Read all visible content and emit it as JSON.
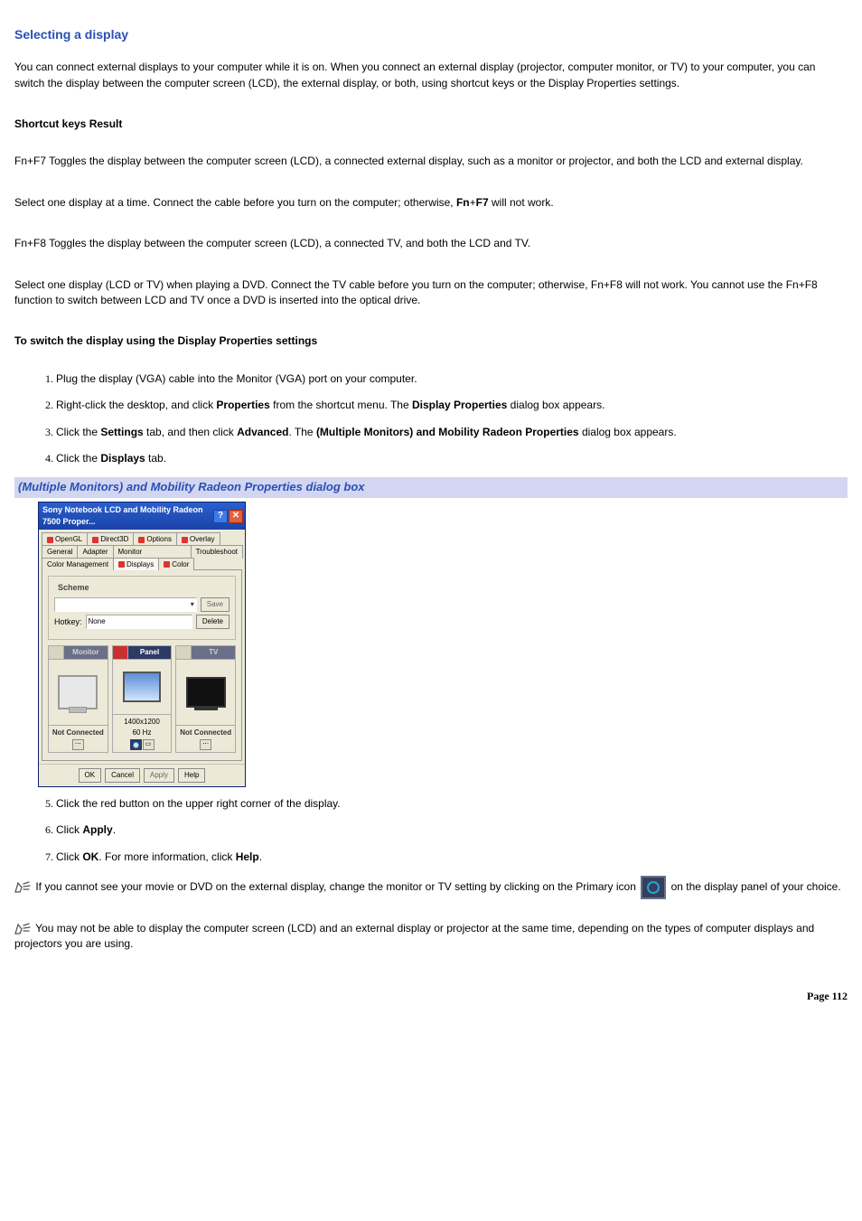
{
  "title": "Selecting a display",
  "intro": "You can connect external displays to your computer while it is on. When you connect an external display (projector, computer monitor, or TV) to your computer, you can switch the display between the computer screen (LCD), the external display, or both, using shortcut keys or the Display Properties settings.",
  "shortcut_header": "Shortcut keys Result",
  "fn_f7": "Fn+F7  Toggles the display between the computer screen (LCD), a connected external display, such as a monitor or projector, and both the LCD and external display.",
  "fn_f7_note_pre": "Select one display at a time. Connect the cable before you turn on the computer; otherwise, ",
  "fn_f7_note_bold1": "Fn",
  "fn_f7_note_plus": "+",
  "fn_f7_note_bold2": "F7",
  "fn_f7_note_post": " will not work.",
  "fn_f8": "Fn+F8  Toggles the display between the computer screen (LCD), a connected TV, and both the LCD and TV.",
  "fn_f8_note": "Select one display (LCD or TV) when playing a DVD. Connect the TV cable before you turn on the computer; otherwise, Fn+F8 will not work. You cannot use the Fn+F8 function to switch between LCD and TV once a DVD is inserted into the optical drive.",
  "switch_heading": "To switch the display using the Display Properties settings",
  "steps1": {
    "s1": "Plug the display (VGA) cable into the Monitor (VGA) port on your computer.",
    "s2a": "Right-click the desktop, and click ",
    "s2b": "Properties",
    "s2c": " from the shortcut menu. The ",
    "s2d": "Display Properties",
    "s2e": " dialog box appears.",
    "s3a": "Click the ",
    "s3b": "Settings",
    "s3c": " tab, and then click ",
    "s3d": "Advanced",
    "s3e": ". The ",
    "s3f": "(Multiple Monitors) and Mobility Radeon Properties",
    "s3g": " dialog box appears.",
    "s4a": "Click the ",
    "s4b": "Displays",
    "s4c": " tab."
  },
  "caption": "(Multiple Monitors) and Mobility Radeon Properties dialog box",
  "dialog": {
    "title": "Sony Notebook LCD and Mobility Radeon 7500 Proper...",
    "tabs_row1": [
      "OpenGL",
      "Direct3D",
      "Options",
      "Overlay"
    ],
    "tabs_row2": [
      "General",
      "Adapter",
      "Monitor"
    ],
    "tabs_row3_left": [
      "Troubleshoot",
      "Color Management"
    ],
    "tabs_row3_displays": "Displays",
    "tabs_row3_color": "Color",
    "scheme_label": "Scheme",
    "save_btn": "Save",
    "hotkey_label": "Hotkey:",
    "hotkey_value": "None",
    "delete_btn": "Delete",
    "col_monitor": "Monitor",
    "col_panel": "Panel",
    "col_tv": "TV",
    "not_connected": "Not Connected",
    "panel_res": "1400x1200",
    "panel_hz": "60 Hz",
    "ok": "OK",
    "cancel": "Cancel",
    "apply": "Apply",
    "help": "Help"
  },
  "steps2": {
    "s5": "Click the red button on the upper right corner of the display.",
    "s6a": "Click ",
    "s6b": "Apply",
    "s6c": ".",
    "s7a": "Click ",
    "s7b": "OK",
    "s7c": ". For more information, click ",
    "s7d": "Help",
    "s7e": "."
  },
  "note1a": " If you cannot see your movie or DVD on the external display, change the monitor or TV setting by clicking on the Primary icon ",
  "note1b": " on the display panel of your choice.",
  "note2": " You may not be able to display the computer screen (LCD) and an external display or projector at the same time, depending on the types of computer displays and projectors you are using.",
  "page": "Page 112"
}
